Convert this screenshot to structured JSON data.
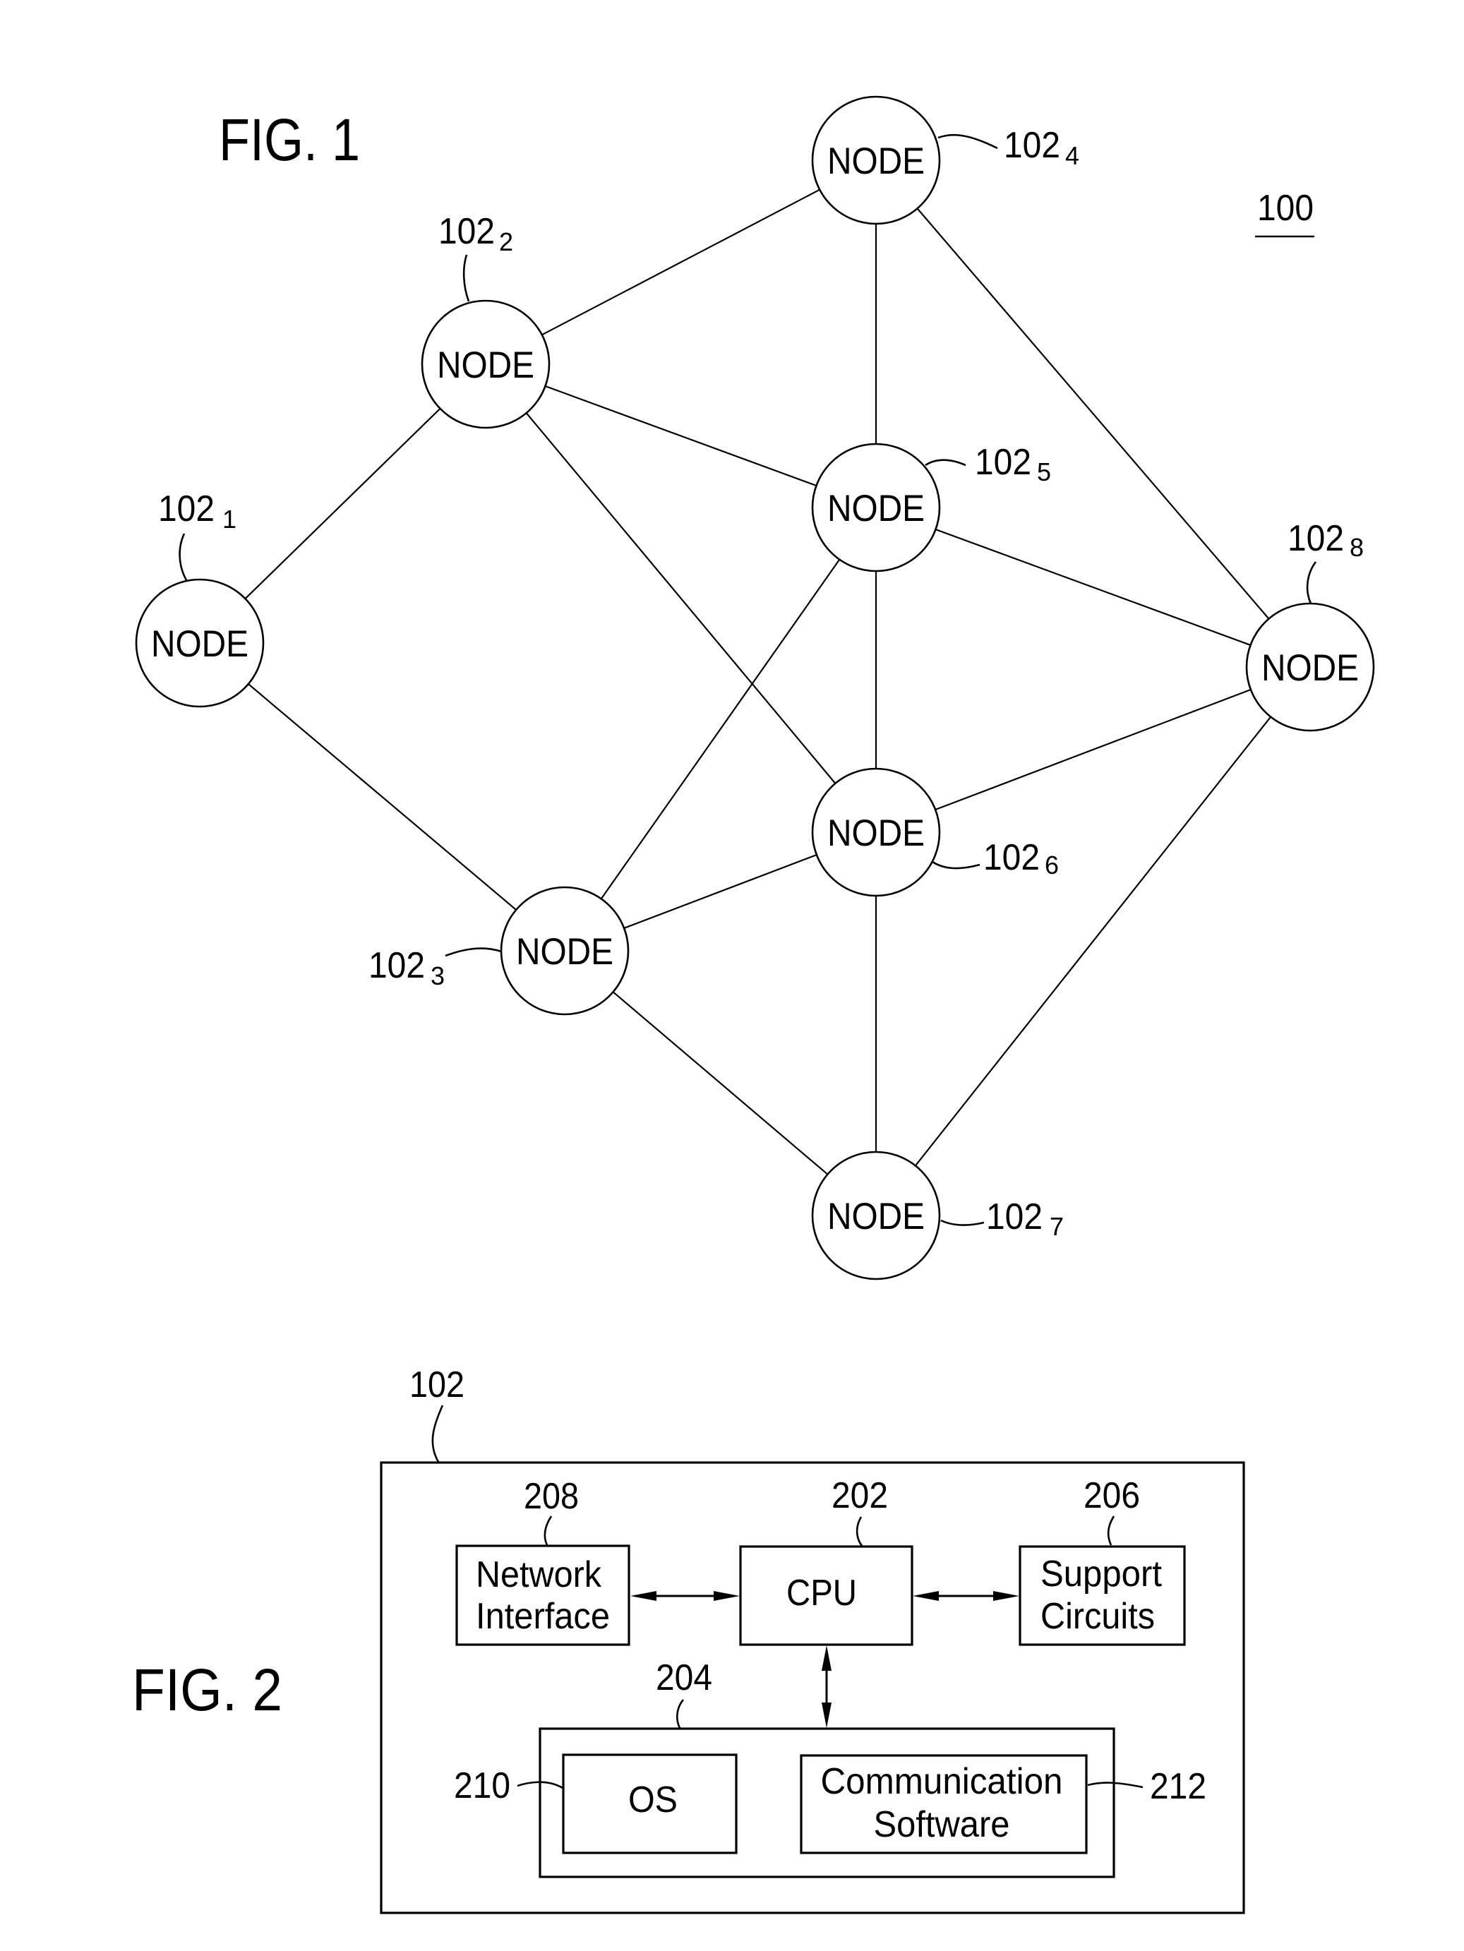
{
  "fig1": {
    "title": "FIG. 1",
    "system_ref": "100",
    "node_label": "NODE",
    "nodes": [
      {
        "id": "1",
        "ref": "102",
        "sub": "1",
        "label": "NODE"
      },
      {
        "id": "2",
        "ref": "102",
        "sub": "2",
        "label": "NODE"
      },
      {
        "id": "3",
        "ref": "102",
        "sub": "3",
        "label": "NODE"
      },
      {
        "id": "4",
        "ref": "102",
        "sub": "4",
        "label": "NODE"
      },
      {
        "id": "5",
        "ref": "102",
        "sub": "5",
        "label": "NODE"
      },
      {
        "id": "6",
        "ref": "102",
        "sub": "6",
        "label": "NODE"
      },
      {
        "id": "7",
        "ref": "102",
        "sub": "7",
        "label": "NODE"
      },
      {
        "id": "8",
        "ref": "102",
        "sub": "8",
        "label": "NODE"
      }
    ],
    "edges": [
      [
        "1",
        "2"
      ],
      [
        "1",
        "3"
      ],
      [
        "2",
        "4"
      ],
      [
        "2",
        "5"
      ],
      [
        "2",
        "6"
      ],
      [
        "3",
        "5"
      ],
      [
        "3",
        "6"
      ],
      [
        "3",
        "7"
      ],
      [
        "4",
        "5"
      ],
      [
        "4",
        "8"
      ],
      [
        "5",
        "6"
      ],
      [
        "5",
        "8"
      ],
      [
        "6",
        "7"
      ],
      [
        "6",
        "8"
      ],
      [
        "7",
        "8"
      ]
    ]
  },
  "fig2": {
    "title": "FIG. 2",
    "device_ref": "102",
    "blocks": {
      "network_interface": {
        "ref": "208",
        "lines": [
          "Network",
          "Interface"
        ]
      },
      "cpu": {
        "ref": "202",
        "lines": [
          "CPU"
        ]
      },
      "support_circuits": {
        "ref": "206",
        "lines": [
          "Support",
          "Circuits"
        ]
      },
      "memory": {
        "ref": "204"
      },
      "os": {
        "ref": "210",
        "lines": [
          "OS"
        ]
      },
      "communication_software": {
        "ref": "212",
        "lines": [
          "Communication",
          "Software"
        ]
      }
    },
    "connections": [
      [
        "network_interface",
        "cpu",
        "bidirectional"
      ],
      [
        "cpu",
        "support_circuits",
        "bidirectional"
      ],
      [
        "cpu",
        "memory",
        "bidirectional"
      ]
    ]
  }
}
